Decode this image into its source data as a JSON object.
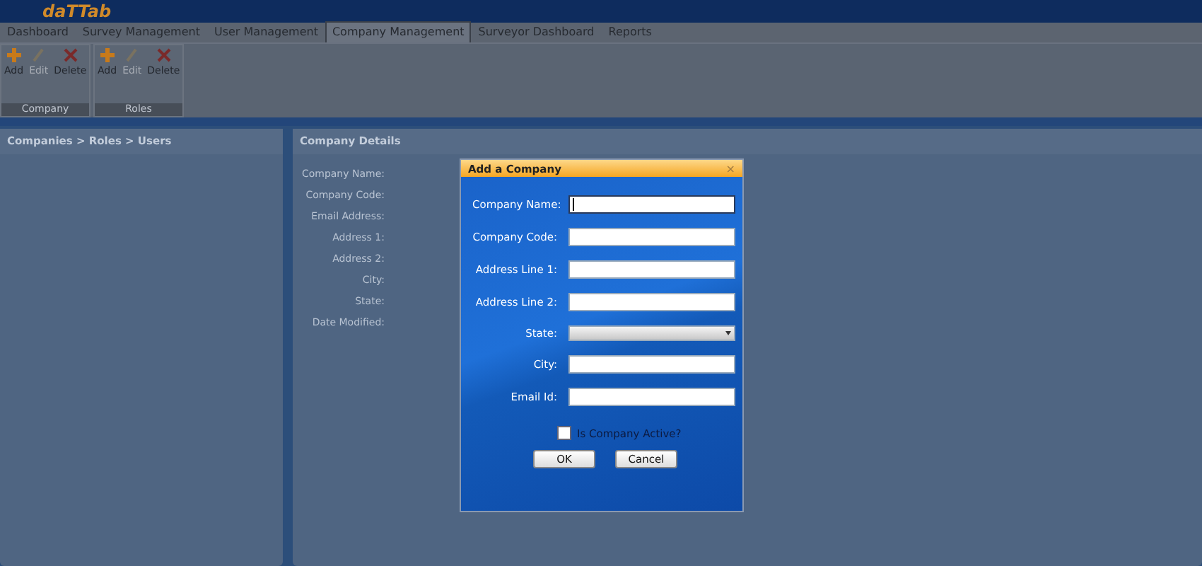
{
  "logo": "daTTab",
  "tabs": [
    {
      "label": "Dashboard",
      "selected": false
    },
    {
      "label": "Survey Management",
      "selected": false
    },
    {
      "label": "User Management",
      "selected": false
    },
    {
      "label": "Company Management",
      "selected": true
    },
    {
      "label": "Surveyor Dashboard",
      "selected": false
    },
    {
      "label": "Reports",
      "selected": false
    }
  ],
  "ribbon_groups": [
    {
      "title": "Company",
      "actions": [
        {
          "kind": "add",
          "label": "Add",
          "disabled": false
        },
        {
          "kind": "edit",
          "label": "Edit",
          "disabled": true
        },
        {
          "kind": "delete",
          "label": "Delete",
          "disabled": false
        }
      ]
    },
    {
      "title": "Roles",
      "actions": [
        {
          "kind": "add",
          "label": "Add",
          "disabled": false
        },
        {
          "kind": "edit",
          "label": "Edit",
          "disabled": true
        },
        {
          "kind": "delete",
          "label": "Delete",
          "disabled": false
        }
      ]
    }
  ],
  "left_panel": {
    "title": "Companies > Roles > Users"
  },
  "details_panel": {
    "title": "Company Details",
    "labels": [
      "Company Name:",
      "Company Code:",
      "Email Address:",
      "Address 1:",
      "Address 2:",
      "City:",
      "State:",
      "Date Modified:"
    ]
  },
  "dialog": {
    "title": "Add a Company",
    "close": "×",
    "fields": [
      {
        "kind": "text",
        "label": "Company Name:",
        "focused": true
      },
      {
        "kind": "text",
        "label": "Company Code:",
        "focused": false
      },
      {
        "kind": "text",
        "label": "Address Line 1:",
        "focused": false
      },
      {
        "kind": "text",
        "label": "Address Line 2:",
        "focused": false
      },
      {
        "kind": "select",
        "label": "State:",
        "focused": false
      },
      {
        "kind": "text",
        "label": "City:",
        "focused": false
      },
      {
        "kind": "text",
        "label": "Email Id:",
        "focused": false
      }
    ],
    "active": {
      "label": "Is Company Active?",
      "checked": false
    },
    "buttons": [
      "OK",
      "Cancel"
    ]
  }
}
